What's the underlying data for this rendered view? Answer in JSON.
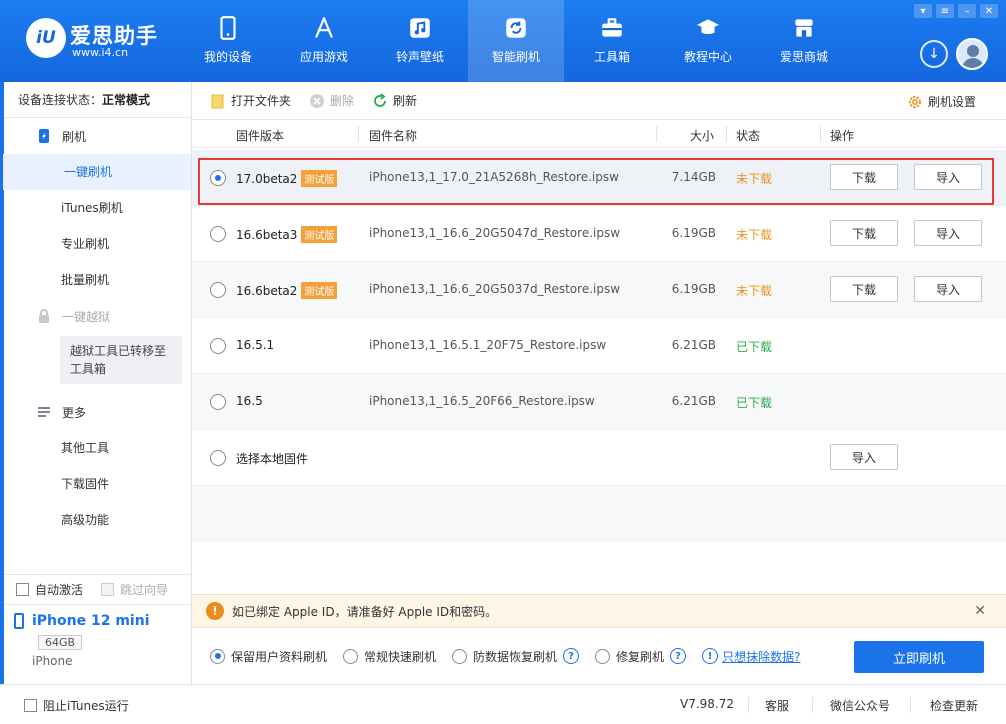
{
  "brand": {
    "name": "爱思助手",
    "url": "www.i4.cn",
    "logo_text": "iU"
  },
  "window_controls": [
    "shirt-icon",
    "minimize",
    "restore",
    "close"
  ],
  "nav": [
    {
      "label": "我的设备",
      "icon": "phone-icon"
    },
    {
      "label": "应用游戏",
      "icon": "app-store-icon"
    },
    {
      "label": "铃声壁纸",
      "icon": "music-icon"
    },
    {
      "label": "智能刷机",
      "icon": "refresh-icon",
      "active": true
    },
    {
      "label": "工具箱",
      "icon": "toolbox-icon"
    },
    {
      "label": "教程中心",
      "icon": "graduation-cap-icon"
    },
    {
      "label": "爱思商城",
      "icon": "shop-icon"
    }
  ],
  "sidebar": {
    "status_label": "设备连接状态：",
    "status_value": "正常模式",
    "group_flash": "刷机",
    "items_flash": [
      "一键刷机",
      "iTunes刷机",
      "专业刷机",
      "批量刷机"
    ],
    "group_jailbreak": "一键越狱",
    "jailbreak_note": "越狱工具已转移至工具箱",
    "group_more": "更多",
    "items_more": [
      "其他工具",
      "下载固件",
      "高级功能"
    ],
    "auto_activate": "自动激活",
    "skip_guide": "跳过向导",
    "device_name": "iPhone 12 mini",
    "device_storage": "64GB",
    "device_model": "iPhone"
  },
  "toolbar": {
    "open_folder": "打开文件夹",
    "delete": "删除",
    "refresh": "刷新",
    "settings": "刷机设置"
  },
  "table": {
    "headers": [
      "固件版本",
      "固件名称",
      "大小",
      "状态",
      "操作"
    ],
    "rows": [
      {
        "version": "17.0beta2",
        "tag": "测试版",
        "file": "iPhone13,1_17.0_21A5268h_Restore.ipsw",
        "size": "7.14GB",
        "status": "未下载",
        "downloaded": false,
        "selected": true
      },
      {
        "version": "16.6beta3",
        "tag": "测试版",
        "file": "iPhone13,1_16.6_20G5047d_Restore.ipsw",
        "size": "6.19GB",
        "status": "未下载",
        "downloaded": false
      },
      {
        "version": "16.6beta2",
        "tag": "测试版",
        "file": "iPhone13,1_16.6_20G5037d_Restore.ipsw",
        "size": "6.19GB",
        "status": "未下载",
        "downloaded": false
      },
      {
        "version": "16.5.1",
        "tag": "",
        "file": "iPhone13,1_16.5.1_20F75_Restore.ipsw",
        "size": "6.21GB",
        "status": "已下载",
        "downloaded": true
      },
      {
        "version": "16.5",
        "tag": "",
        "file": "iPhone13,1_16.5_20F66_Restore.ipsw",
        "size": "6.21GB",
        "status": "已下载",
        "downloaded": true
      }
    ],
    "local_firmware": "选择本地固件",
    "btn_download": "下载",
    "btn_import": "导入"
  },
  "alert": {
    "text": "如已绑定 Apple ID，请准备好 Apple ID和密码。"
  },
  "options": {
    "keep_data": "保留用户资料刷机",
    "quick": "常规快速刷机",
    "anti_loss": "防数据恢复刷机",
    "repair": "修复刷机",
    "erase_link": "只想抹除数据?",
    "flash_now": "立即刷机"
  },
  "statusbar": {
    "block_itunes": "阻止iTunes运行",
    "version": "V7.98.72",
    "service": "客服",
    "wechat": "微信公众号",
    "update": "检查更新"
  }
}
